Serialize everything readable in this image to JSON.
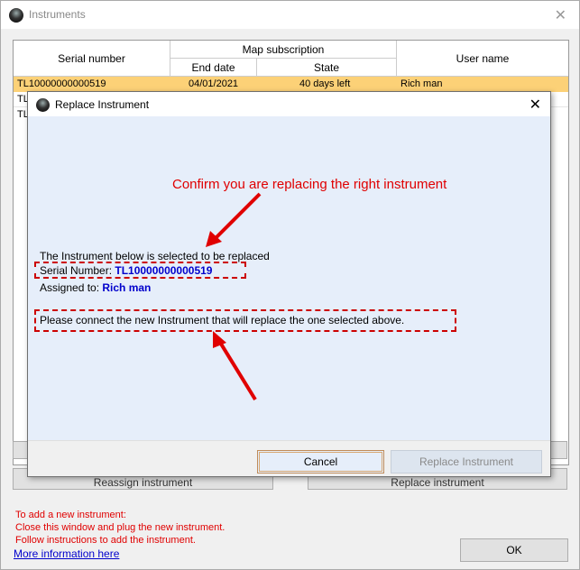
{
  "window": {
    "title": "Instruments",
    "close_symbol": "✕"
  },
  "table": {
    "headers": {
      "serial": "Serial number",
      "map_subscription": "Map subscription",
      "end_date": "End date",
      "state": "State",
      "user": "User name"
    },
    "rows": [
      {
        "serial": "TL10000000000519",
        "end_date": "04/01/2021",
        "state": "40 days left",
        "user": "Rich man",
        "selected": true
      },
      {
        "serial": "TL",
        "end_date": "",
        "state": "",
        "user": "",
        "selected": false
      },
      {
        "serial": "TL",
        "end_date": "",
        "state": "",
        "user": "",
        "selected": false
      }
    ]
  },
  "background_buttons": {
    "reassign": "Reassign instrument",
    "replace": "Replace instrument"
  },
  "note": {
    "line1": "To add a new instrument:",
    "line2": "Close this window and plug the new instrument.",
    "line3": "Follow instructions to add the instrument."
  },
  "more_info_link": "More information here",
  "ok_button": "OK",
  "dialog": {
    "title": "Replace Instrument",
    "close_symbol": "✕",
    "confirm_text": "Confirm you are replacing the right instrument",
    "selected_line": "The Instrument  below is selected to be replaced",
    "serial_label": "Serial Number: ",
    "serial_value": "TL10000000000519",
    "assigned_label": "Assigned to: ",
    "assigned_value": "Rich man",
    "connect_text": "Please connect the new Instrument that will replace the one selected above.",
    "cancel_button": "Cancel",
    "replace_button": "Replace Instrument"
  },
  "colors": {
    "annotation_red": "#e00000",
    "value_blue": "#0000cc",
    "selected_row": "#fcd177",
    "dialog_bg": "#e6eefa"
  }
}
